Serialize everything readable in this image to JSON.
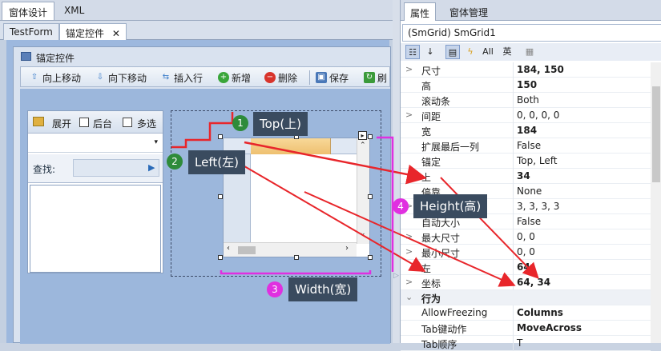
{
  "top_tabs": [
    {
      "label": "窗体设计"
    },
    {
      "label": "XML"
    }
  ],
  "doc_tabs": [
    {
      "label": "TestForm"
    },
    {
      "label": "锚定控件",
      "close": "✕"
    }
  ],
  "form": {
    "title": "锚定控件"
  },
  "toolbar": [
    {
      "label": "向上移动",
      "icon": "arrow-up-icon"
    },
    {
      "label": "向下移动",
      "icon": "arrow-down-icon"
    },
    {
      "label": "插入行",
      "icon": "insert-row-icon"
    },
    {
      "label": "新增",
      "icon": "add-icon"
    },
    {
      "label": "删除",
      "icon": "delete-icon"
    },
    {
      "label": "保存",
      "icon": "save-icon"
    },
    {
      "label": "刷",
      "icon": "refresh-icon"
    }
  ],
  "panel": {
    "expand": "展开",
    "backend": "后台",
    "multi": "多选",
    "search_label": "查找:"
  },
  "callouts": {
    "top": "Top(上)",
    "left": "Left(左)",
    "height": "Height(高)",
    "width": "Width(宽)",
    "n1": "1",
    "n2": "2",
    "n3": "3",
    "n4": "4"
  },
  "props": {
    "tabs": [
      {
        "label": "属性"
      },
      {
        "label": "窗体管理"
      }
    ],
    "object": "(SmGrid) SmGrid1",
    "toolbar_all": "All",
    "toolbar_lang": "英",
    "rows": [
      {
        "exp": ">",
        "name": "尺寸",
        "value": "184, 150",
        "bold": true
      },
      {
        "exp": "",
        "name": "高",
        "value": "150",
        "bold": true
      },
      {
        "exp": "",
        "name": "滚动条",
        "value": "Both",
        "bold": false
      },
      {
        "exp": ">",
        "name": "间距",
        "value": "0, 0, 0, 0",
        "bold": false
      },
      {
        "exp": "",
        "name": "宽",
        "value": "184",
        "bold": true
      },
      {
        "exp": "",
        "name": "扩展最后一列",
        "value": "False",
        "bold": false
      },
      {
        "exp": "",
        "name": "锚定",
        "value": "Top, Left",
        "bold": false
      },
      {
        "exp": "",
        "name": "上",
        "value": "34",
        "bold": true
      },
      {
        "exp": "",
        "name": "停靠",
        "value": "None",
        "bold": false
      },
      {
        "exp": ">",
        "name": "内边距",
        "value": "3, 3, 3, 3",
        "bold": false
      },
      {
        "exp": "",
        "name": "自动大小",
        "value": "False",
        "bold": false
      },
      {
        "exp": ">",
        "name": "最大尺寸",
        "value": "0, 0",
        "bold": false
      },
      {
        "exp": ">",
        "name": "最小尺寸",
        "value": "0, 0",
        "bold": false
      },
      {
        "exp": "",
        "name": "左",
        "value": "64",
        "bold": true
      },
      {
        "exp": ">",
        "name": "坐标",
        "value": "64, 34",
        "bold": true
      },
      {
        "exp": "⌄",
        "name": "行为",
        "value": "",
        "bold": true,
        "category": true
      },
      {
        "exp": "",
        "name": "AllowFreezing",
        "value": "Columns",
        "bold": true
      },
      {
        "exp": "",
        "name": "Tab键动作",
        "value": "MoveAcross",
        "bold": true
      },
      {
        "exp": "",
        "name": "Tab顺序",
        "value": "T",
        "bold": false
      }
    ]
  },
  "colors": {
    "callout_bg": "#3a4b5f",
    "red": "#e8262b",
    "magenta": "#e030e0",
    "green": "#2e8b3a"
  }
}
